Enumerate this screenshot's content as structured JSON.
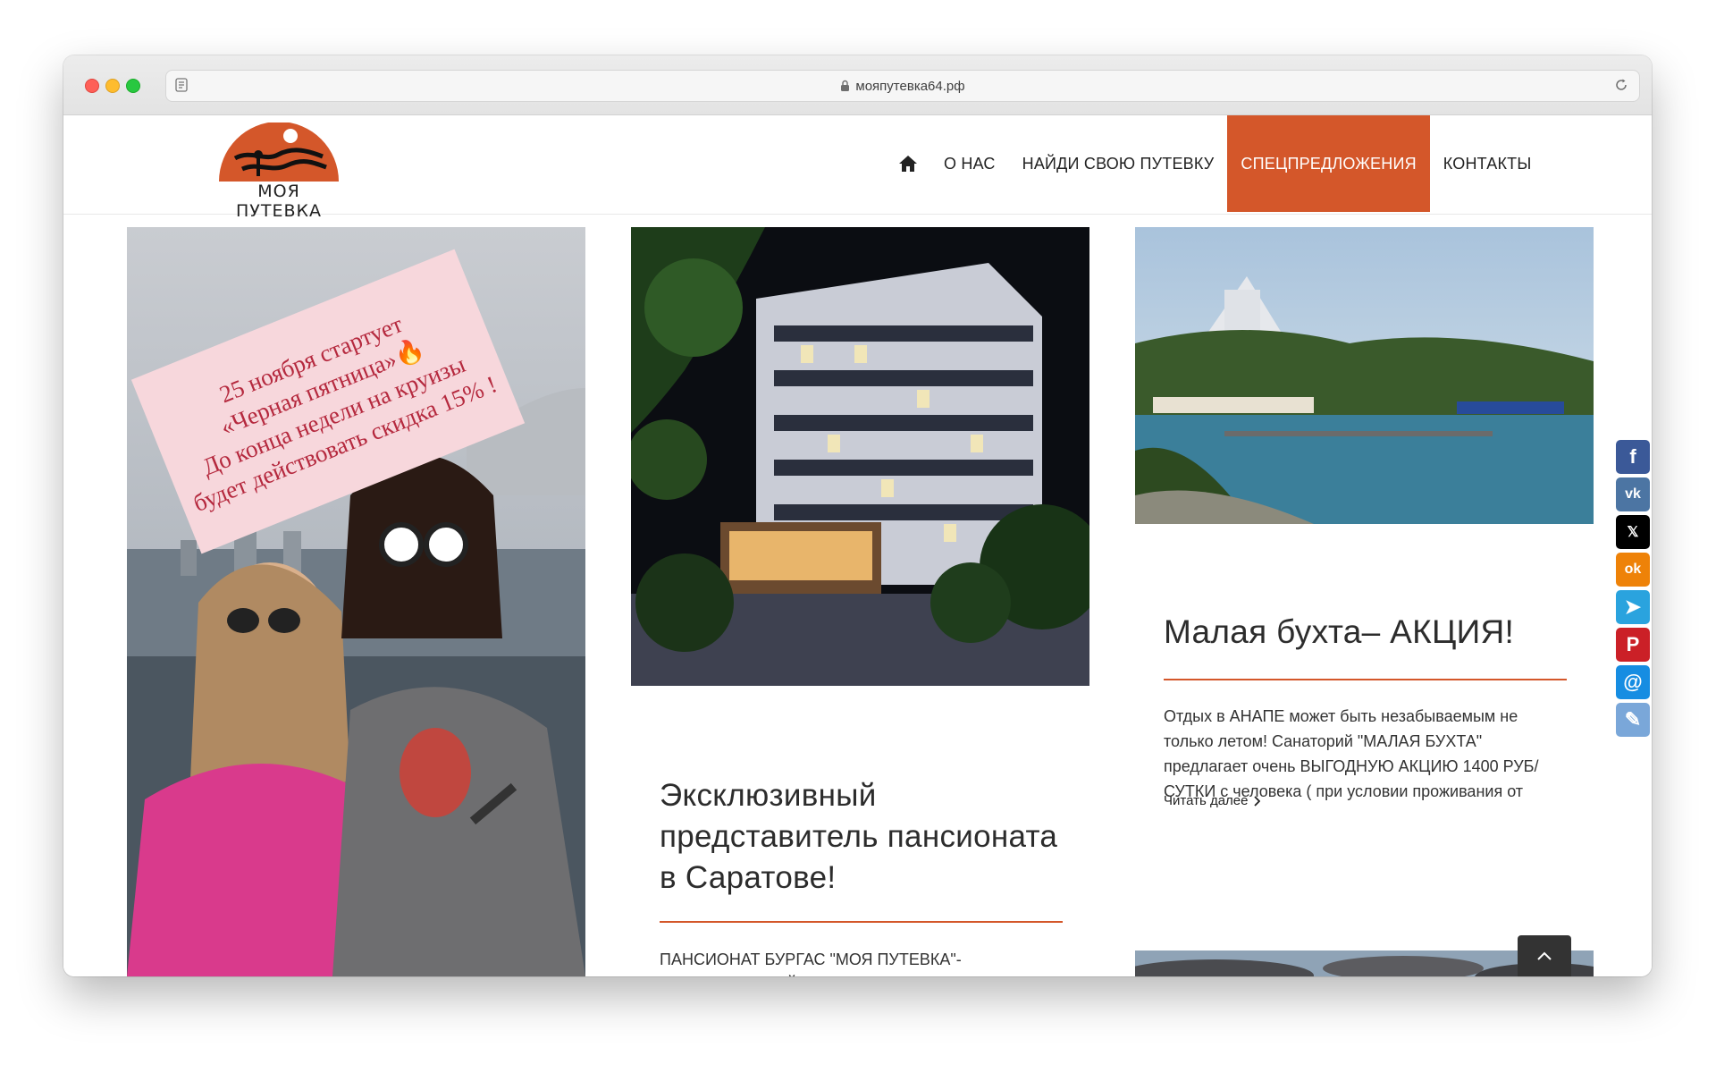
{
  "browser": {
    "url": "мояпутевка64.рф"
  },
  "site": {
    "logo_text": "МОЯ ПУТЕВКА",
    "accent_color": "#d4572a"
  },
  "nav": {
    "home_icon": "home-icon",
    "items": [
      {
        "label": "О НАС"
      },
      {
        "label": "НАЙДИ СВОЮ ПУТЕВКУ"
      },
      {
        "label": "СПЕЦПРЕДЛОЖЕНИЯ",
        "active": true
      },
      {
        "label": "КОНТАКТЫ"
      }
    ]
  },
  "promo": {
    "lines": [
      "25 ноября стартует",
      "«Черная пятница»🔥",
      "До конца недели на круизы",
      "будет действовать скидка 15% !"
    ]
  },
  "post2": {
    "title": "Эксклюзивный представитель пансионата в Саратове!",
    "text": "ПАНСИОНАТ БУРГАС \"МОЯ ПУТЕВКА\"- ЭКСКЛЮЗИВНЫЙ ПРЕДСТАВИТЕЛЬ ПАНСИОНАТА В САРАТОВЕ Расположен на самом берегу Черного моря в курортной зоне"
  },
  "post3": {
    "title": "Малая бухта– АКЦИЯ!",
    "text": "Отдых в АНАПЕ может быть незабываемым не только летом! Санаторий \"МАЛАЯ БУХТА\" предлагает очень ВЫГОДНУЮ АКЦИЮ 1400 РУБ/СУТКИ с человека ( при условии проживания от",
    "read_more": "Читать далее"
  },
  "social": [
    {
      "name": "facebook-icon",
      "glyph": "f",
      "color": "#3b5998"
    },
    {
      "name": "vk-icon",
      "glyph": "vk",
      "color": "#4c75a3"
    },
    {
      "name": "x-icon",
      "glyph": "𝕏",
      "color": "#000000"
    },
    {
      "name": "odnoklassniki-icon",
      "glyph": "ok",
      "color": "#ee8208"
    },
    {
      "name": "telegram-icon",
      "glyph": "➤",
      "color": "#2aa3de"
    },
    {
      "name": "pinterest-icon",
      "glyph": "P",
      "color": "#cb2027"
    },
    {
      "name": "mail-icon",
      "glyph": "@",
      "color": "#168de2"
    },
    {
      "name": "attachment-icon",
      "glyph": "✎",
      "color": "#7aa7d9"
    }
  ]
}
